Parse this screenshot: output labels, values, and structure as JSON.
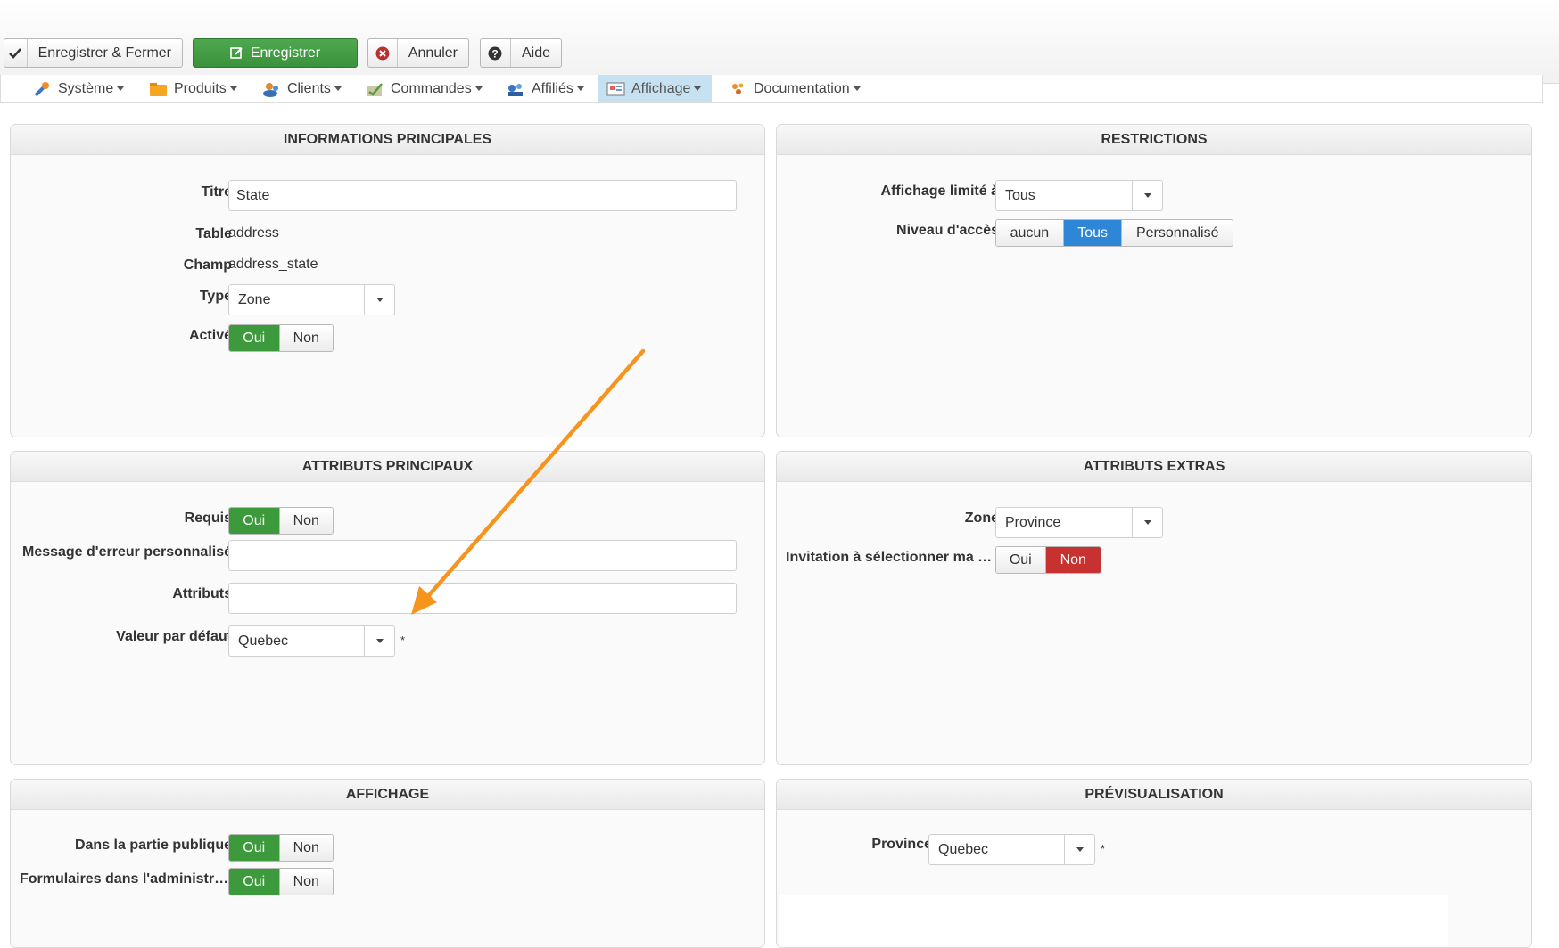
{
  "toolbar": {
    "save_close": "Enregistrer & Fermer",
    "save": "Enregistrer",
    "cancel": "Annuler",
    "help": "Aide"
  },
  "menu": {
    "items": [
      {
        "label": "Système",
        "icon": "wrench-icon"
      },
      {
        "label": "Produits",
        "icon": "folder-icon"
      },
      {
        "label": "Clients",
        "icon": "users-icon"
      },
      {
        "label": "Commandes",
        "icon": "orders-icon"
      },
      {
        "label": "Affiliés",
        "icon": "affiliates-icon"
      },
      {
        "label": "Affichage",
        "icon": "display-icon",
        "active": true
      },
      {
        "label": "Documentation",
        "icon": "documentation-icon"
      }
    ]
  },
  "main_info": {
    "title": "INFORMATIONS PRINCIPALES",
    "titre_label": "Titre",
    "titre_value": "State",
    "table_label": "Table",
    "table_value": "address",
    "champ_label": "Champ",
    "champ_value": "address_state",
    "type_label": "Type",
    "type_value": "Zone",
    "active_label": "Activé",
    "yes": "Oui",
    "no": "Non",
    "active_value": "Oui"
  },
  "restrictions": {
    "title": "RESTRICTIONS",
    "limit_label": "Affichage limité à",
    "limit_value": "Tous",
    "access_label": "Niveau d'accès",
    "access_options": [
      "aucun",
      "Tous",
      "Personnalisé"
    ],
    "access_value": "Tous"
  },
  "main_attrs": {
    "title": "ATTRIBUTS PRINCIPAUX",
    "required_label": "Requis",
    "required_value": "Oui",
    "error_msg_label": "Message d'erreur personnalisé",
    "error_msg_value": "",
    "attributes_label": "Attributs",
    "attributes_value": "",
    "default_label": "Valeur par défaut",
    "default_value": "Quebec",
    "asterisk": "*"
  },
  "extra_attrs": {
    "title": "ATTRIBUTS EXTRAS",
    "zone_label": "Zone",
    "zone_value": "Province",
    "invite_label": "Invitation à sélectionner ma zone",
    "invite_value": "Non"
  },
  "display": {
    "title": "AFFICHAGE",
    "public_label": "Dans la partie publique",
    "public_value": "Oui",
    "admin_label": "Formulaires dans l'administration",
    "admin_value": "Oui"
  },
  "preview": {
    "title": "PRÉVISUALISATION",
    "province_label": "Province",
    "province_value": "Quebec",
    "asterisk": "*"
  },
  "colors": {
    "green": "#3c9a3c",
    "blue": "#2d87d6",
    "red": "#c7312f",
    "annotation_arrow": "#f7941d"
  }
}
